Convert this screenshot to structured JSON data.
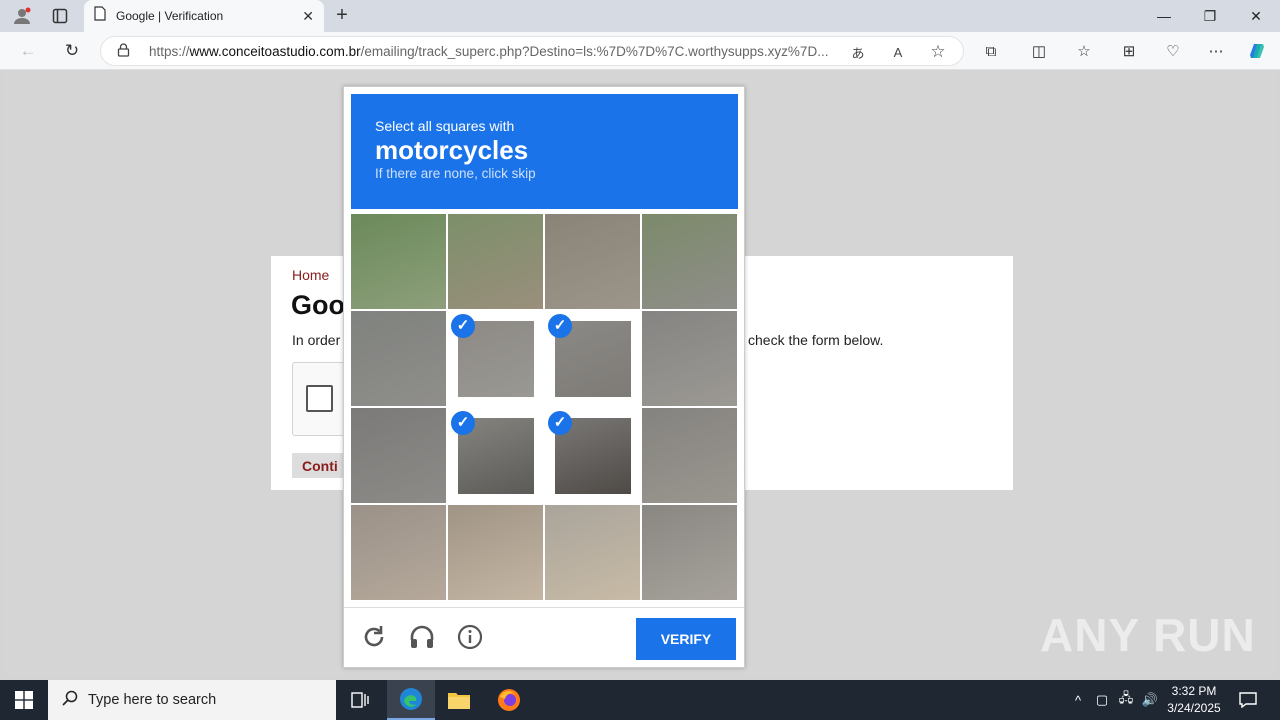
{
  "browser": {
    "tab_title": "Google | Verification",
    "url_prefix": "https://",
    "url_host": "www.conceitoastudio.com.br",
    "url_path": "/emailing/track_superc.php?Destino=ls:%7D%7D%7C.worthysupps.xyz%7D..."
  },
  "page": {
    "home_link": "Home",
    "heading": "Goo",
    "intro_left": "In order",
    "intro_right": "check the form below.",
    "continue_label": "Conti"
  },
  "captcha": {
    "intro": "Select all squares with",
    "target": "motorcycles",
    "hint": "If there are none, click skip",
    "verify_label": "VERIFY",
    "selected_tiles": [
      5,
      6,
      9,
      10
    ]
  },
  "taskbar": {
    "search_placeholder": "Type here to search",
    "time": "3:32 PM",
    "date": "3/24/2025"
  },
  "watermark": "ANY RUN",
  "colors": {
    "accent": "#1a73e8",
    "link": "#8b1c1c",
    "taskbar": "#1f2733"
  }
}
